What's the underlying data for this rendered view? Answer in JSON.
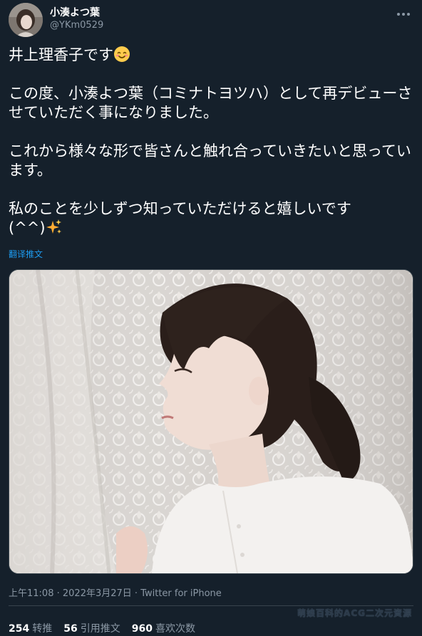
{
  "user": {
    "display_name": "小湊よつ葉",
    "handle": "@YKm0529"
  },
  "tweet": {
    "paragraphs": [
      "井上理香子です",
      "この度、小湊よつ葉（コミナトヨツハ）として再デビューさせていただく事になりました。",
      "これから様々な形で皆さんと触れ合っていきたいと思っています。",
      "私のことを少しずつ知っていただけると嬉しいです\n(^^)"
    ],
    "translate_label": "翻译推文"
  },
  "meta": {
    "time": "上午11:08",
    "separator1": " · ",
    "date": "2022年3月27日",
    "separator2": " · ",
    "source": "Twitter for iPhone"
  },
  "stats": {
    "retweets_count": "254",
    "retweets_label": "转推",
    "quotes_count": "56",
    "quotes_label": "引用推文",
    "likes_count": "960",
    "likes_label": "喜欢次数"
  },
  "watermark": "萌娘百科的ACG二次元資源",
  "icons": {
    "more": "more-horizontal-icon",
    "smile_emoji": "smiling-face-emoji",
    "sparkles_emoji": "sparkles-emoji"
  },
  "colors": {
    "background": "#15202b",
    "text_secondary": "#8b98a5",
    "link": "#1d9bf0",
    "divider": "#38444d"
  }
}
